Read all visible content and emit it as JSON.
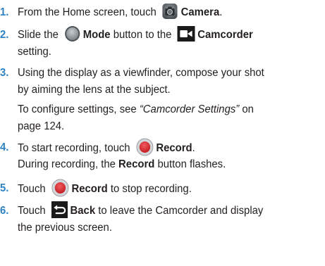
{
  "steps": [
    {
      "num": "1.",
      "pre": "From the Home screen, touch",
      "bold": "Camera",
      "post": "."
    },
    {
      "num": "2.",
      "a": "Slide the",
      "mode": "Mode",
      "b": "button to the",
      "camcorder": "Camcorder",
      "c": "setting."
    },
    {
      "num": "3.",
      "l1": "Using the display as a viewfinder, compose your shot",
      "l2": "by aiming the lens at the subject.",
      "l3a": "To configure settings, see",
      "l3ref": "“Camcorder Settings”",
      "l3b": "on",
      "l4": "page 124."
    },
    {
      "num": "4.",
      "pre": "To start recording, touch",
      "bold": "Record",
      "post": ".",
      "l2a": "During recording, the",
      "l2b": "Record",
      "l2c": "button flashes."
    },
    {
      "num": "5.",
      "pre": "Touch",
      "bold": "Record",
      "post": "to stop recording."
    },
    {
      "num": "6.",
      "pre": "Touch",
      "bold": "Back",
      "post": "to leave the Camcorder and display",
      "l2": "the previous screen."
    }
  ],
  "icons": [
    "camera-icon",
    "mode-button-icon",
    "camcorder-icon",
    "record-icon",
    "back-icon"
  ],
  "colors": {
    "step_number": "#2f82c2",
    "record": "#e2262f",
    "text": "#231f20"
  }
}
